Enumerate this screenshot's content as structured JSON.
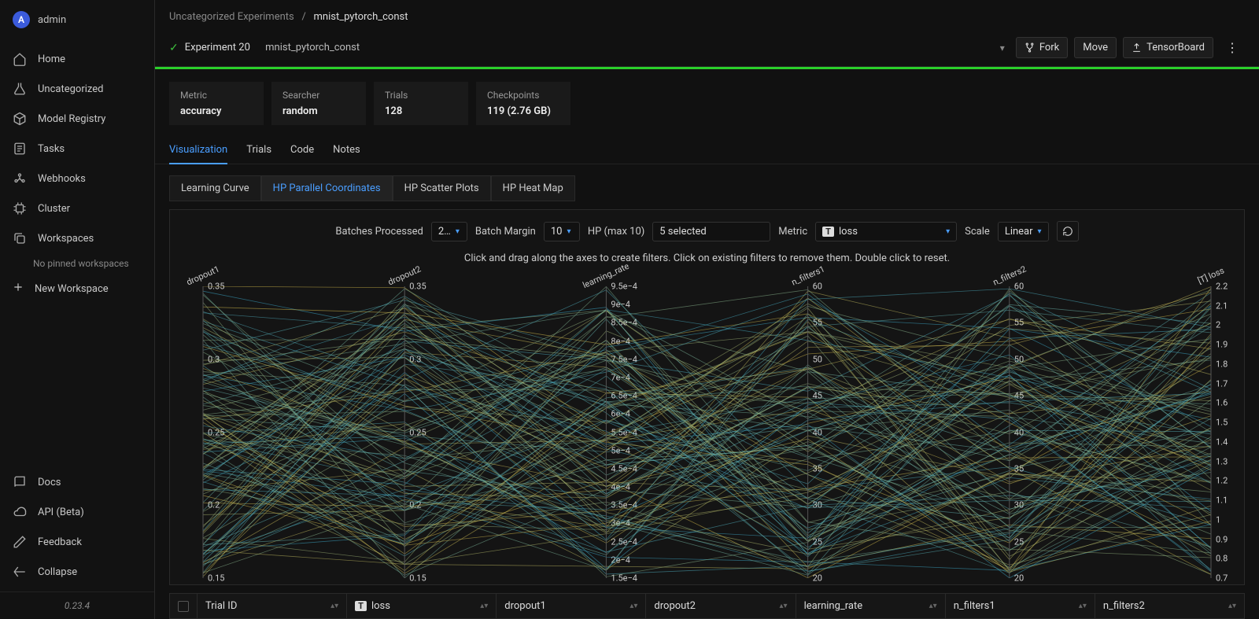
{
  "user": {
    "initial": "A",
    "name": "admin"
  },
  "sidebar": {
    "items": [
      {
        "label": "Home"
      },
      {
        "label": "Uncategorized"
      },
      {
        "label": "Model Registry"
      },
      {
        "label": "Tasks"
      },
      {
        "label": "Webhooks"
      },
      {
        "label": "Cluster"
      },
      {
        "label": "Workspaces"
      }
    ],
    "no_pinned": "No pinned workspaces",
    "new_workspace": "New Workspace",
    "bottom": [
      {
        "label": "Docs"
      },
      {
        "label": "API (Beta)"
      },
      {
        "label": "Feedback"
      },
      {
        "label": "Collapse"
      }
    ],
    "version": "0.23.4"
  },
  "breadcrumb": {
    "parent": "Uncategorized Experiments",
    "sep": "/",
    "current": "mnist_pytorch_const"
  },
  "header": {
    "title": "Experiment 20",
    "name": "mnist_pytorch_const",
    "fork": "Fork",
    "move": "Move",
    "tensorboard": "TensorBoard"
  },
  "stats": [
    {
      "label": "Metric",
      "value": "accuracy"
    },
    {
      "label": "Searcher",
      "value": "random"
    },
    {
      "label": "Trials",
      "value": "128"
    },
    {
      "label": "Checkpoints",
      "value": "119 (2.76 GB)"
    }
  ],
  "tabs": [
    "Visualization",
    "Trials",
    "Code",
    "Notes"
  ],
  "subtabs": [
    "Learning Curve",
    "HP Parallel Coordinates",
    "HP Scatter Plots",
    "HP Heat Map"
  ],
  "controls": {
    "batches_label": "Batches Processed",
    "batches_value": "2…",
    "margin_label": "Batch Margin",
    "margin_value": "10",
    "hp_label": "HP (max 10)",
    "hp_value": "5 selected",
    "metric_label": "Metric",
    "metric_badge": "T",
    "metric_value": "loss",
    "scale_label": "Scale",
    "scale_value": "Linear"
  },
  "helper_text": "Click and drag along the axes to create filters. Click on existing filters to remove them. Double click to reset.",
  "table_headers": [
    "Trial ID",
    "loss",
    "dropout1",
    "dropout2",
    "learning_rate",
    "n_filters1",
    "n_filters2"
  ],
  "chart_data": {
    "type": "parallel_coordinates",
    "axes": [
      {
        "name": "dropout1",
        "range": [
          0.1,
          0.4
        ],
        "ticks": [
          "0.35",
          "0.3",
          "0.25",
          "0.2",
          "0.15"
        ]
      },
      {
        "name": "dropout2",
        "range": [
          0.1,
          0.4
        ],
        "ticks": [
          "0.35",
          "0.3",
          "0.25",
          "0.2",
          "0.15"
        ]
      },
      {
        "name": "learning_rate",
        "range": [
          0.00015,
          0.00095
        ],
        "ticks": [
          "9.5e−4",
          "9e−4",
          "8.5e−4",
          "8e−4",
          "7.5e−4",
          "7e−4",
          "6.5e−4",
          "6e−4",
          "5.5e−4",
          "5e−4",
          "4.5e−4",
          "4e−4",
          "3.5e−4",
          "3e−4",
          "2.5e−4",
          "2e−4",
          "1.5e−4"
        ]
      },
      {
        "name": "n_filters1",
        "range": [
          15,
          65
        ],
        "ticks": [
          "60",
          "55",
          "50",
          "45",
          "40",
          "35",
          "30",
          "25",
          "20"
        ]
      },
      {
        "name": "n_filters2",
        "range": [
          15,
          65
        ],
        "ticks": [
          "60",
          "55",
          "50",
          "45",
          "40",
          "35",
          "30",
          "25",
          "20"
        ]
      },
      {
        "name": "[T] loss",
        "range": [
          0.7,
          2.3
        ],
        "ticks": [
          "2.2",
          "2.1",
          "2",
          "1.9",
          "1.8",
          "1.7",
          "1.6",
          "1.5",
          "1.4",
          "1.3",
          "1.2",
          "1.1",
          "1",
          "0.9",
          "0.8",
          "0.7"
        ]
      }
    ],
    "color_by": "[T] loss",
    "color_scale": [
      "#d4b94a",
      "#3aa8c9"
    ],
    "n_lines": 128
  }
}
